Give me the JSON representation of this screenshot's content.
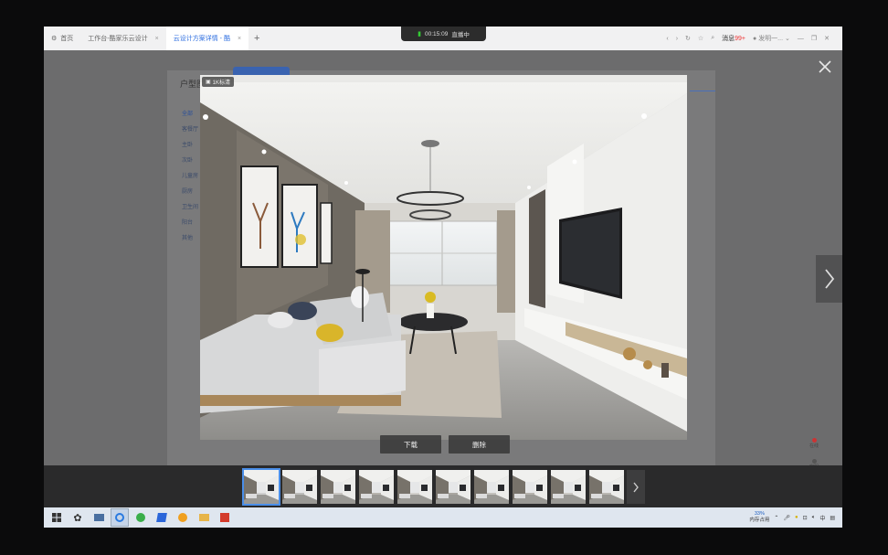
{
  "browser": {
    "tabs": [
      {
        "label": "首页",
        "active": false
      },
      {
        "label": "工作台-酷家乐云设计",
        "active": false
      },
      {
        "label": "云设计方案详情 - 酷",
        "active": true
      }
    ],
    "new_tab": "+",
    "message_label": "消息",
    "message_badge": "99+",
    "user_name": "发明一..."
  },
  "recording": {
    "time": "00:15:09",
    "status": "直播中"
  },
  "background_page": {
    "header": "户型图",
    "side_items": [
      "全部",
      "客餐厅",
      "主卧",
      "次卧",
      "儿童房",
      "厨房",
      "卫生间",
      "阳台",
      "其他"
    ],
    "right_buttons": [
      "在线",
      "客服"
    ]
  },
  "viewer": {
    "tag_label": "1K标清",
    "download_label": "下载",
    "delete_label": "删除"
  },
  "thumbnails": {
    "count": 10,
    "selected_index": 0
  },
  "taskbar": {
    "memory_percent": "33%",
    "memory_label": "内存占用",
    "ime": "中"
  },
  "colors": {
    "accent": "#2f6fe0",
    "selected_outline": "#4a8ee8",
    "record_signal": "#33cc33"
  }
}
